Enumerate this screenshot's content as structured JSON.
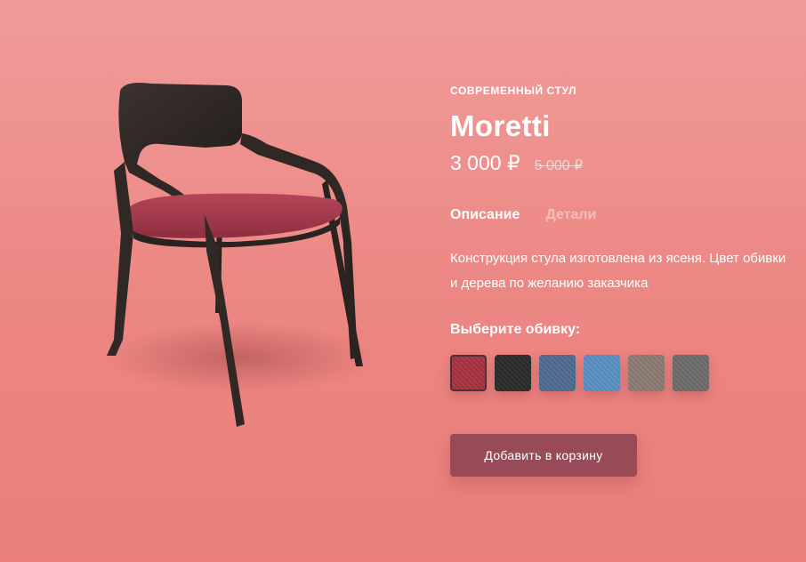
{
  "product": {
    "category": "Современный стул",
    "name": "Moretti",
    "price": "3 000 ₽",
    "old_price": "5 000 ₽",
    "image_alt": "chair-image"
  },
  "tabs": [
    {
      "label": "Описание",
      "active": true
    },
    {
      "label": "Детали",
      "active": false
    }
  ],
  "description": "Конструкция стула изготовлена из ясеня. Цвет обивки и дерева по желанию заказчика",
  "upholstery": {
    "label": "Выберите обивку:",
    "options": [
      {
        "color": "#a8323f",
        "selected": true
      },
      {
        "color": "#2a2b2d",
        "selected": false
      },
      {
        "color": "#4f6c8f",
        "selected": false
      },
      {
        "color": "#5a8fc2",
        "selected": false
      },
      {
        "color": "#8a7a72",
        "selected": false
      },
      {
        "color": "#6d6c6b",
        "selected": false
      }
    ]
  },
  "cart_button": "Добавить в корзину",
  "colors": {
    "background": "#ec8682",
    "button": "#984b56",
    "chair_frame": "#2f2825",
    "seat": "#a23a4a"
  }
}
